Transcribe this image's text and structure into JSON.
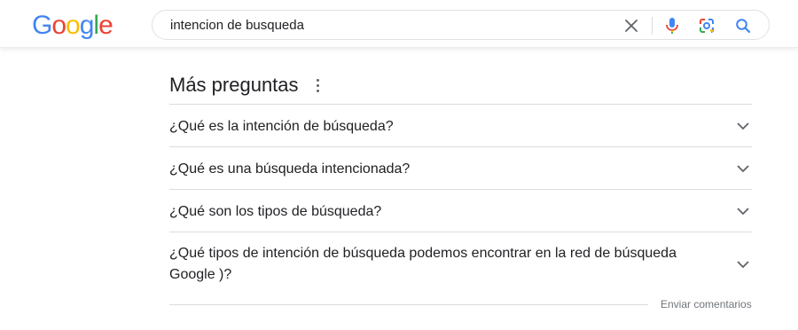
{
  "logo": {
    "letters": [
      "G",
      "o",
      "o",
      "g",
      "l",
      "e"
    ],
    "colors": [
      "#4285F4",
      "#EA4335",
      "#FBBC05",
      "#4285F4",
      "#34A853",
      "#EA4335"
    ]
  },
  "search": {
    "query": "intencion de busqueda",
    "icons": [
      "close-icon",
      "microphone-icon",
      "lens-icon",
      "search-icon"
    ]
  },
  "section": {
    "title": "Más preguntas",
    "menu_icon": "more-vert-icon"
  },
  "questions": [
    {
      "text": "¿Qué es la intención de búsqueda?"
    },
    {
      "text": "¿Qué es una búsqueda intencionada?"
    },
    {
      "text": "¿Qué son los tipos de búsqueda?"
    },
    {
      "text": "¿Qué tipos de intención de búsqueda podemos encontrar en la red de búsqueda Google )?"
    }
  ],
  "footer": {
    "feedback_label": "Enviar comentarios"
  },
  "colors": {
    "text": "#202124",
    "secondary": "#70757a",
    "divider": "#dadce0",
    "blue": "#4285F4"
  }
}
